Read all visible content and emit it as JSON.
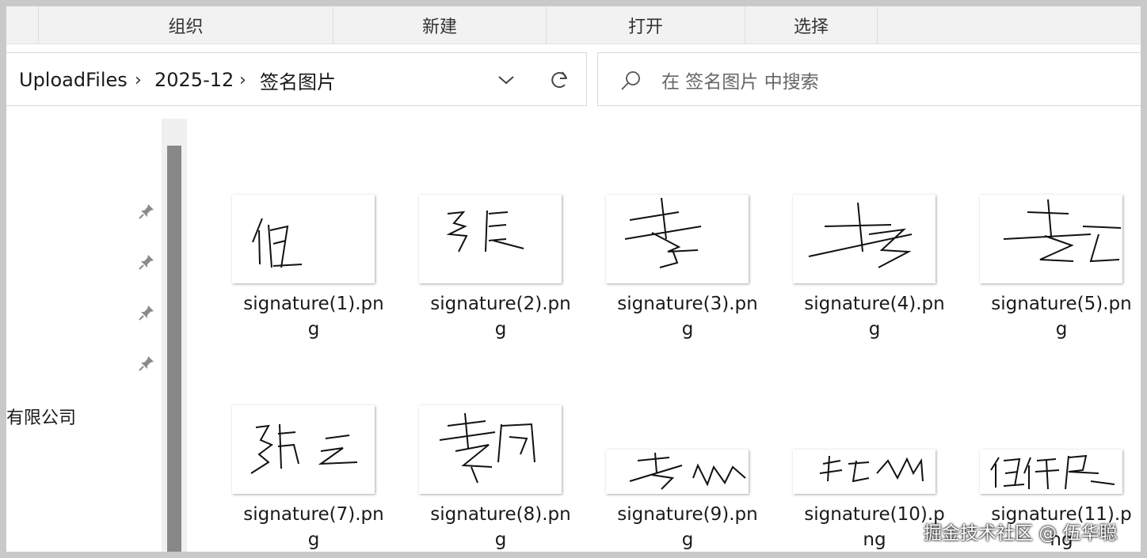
{
  "ribbon": {
    "organize": "组织",
    "new": "新建",
    "open": "打开",
    "select": "选择"
  },
  "address": {
    "crumbs": [
      "UploadFiles",
      "2025-12",
      "签名图片"
    ],
    "separator": "›",
    "icons": [
      "chevron-down-icon",
      "refresh-icon"
    ]
  },
  "search": {
    "placeholder": "在 签名图片 中搜索",
    "icon": "search-icon"
  },
  "nav": {
    "pins": [
      "pin-icon",
      "pin-icon",
      "pin-icon",
      "pin-icon"
    ],
    "item_label": "有限公司"
  },
  "files": [
    {
      "line1": "signature(1).pn",
      "line2": "g"
    },
    {
      "line1": "signature(2).pn",
      "line2": "g"
    },
    {
      "line1": "signature(3).pn",
      "line2": "g"
    },
    {
      "line1": "signature(4).pn",
      "line2": "g"
    },
    {
      "line1": "signature(5).pn",
      "line2": "g"
    },
    {
      "line1": "signature(7).pn",
      "line2": "g"
    },
    {
      "line1": "signature(8).pn",
      "line2": "g"
    },
    {
      "line1": "signature(9).pn",
      "line2": "g"
    },
    {
      "line1": "signature(10).p",
      "line2": "ng"
    },
    {
      "line1": "signature(11).p",
      "line2": "ng"
    }
  ],
  "watermark": "掘金技术社区 @ 伍华聪"
}
